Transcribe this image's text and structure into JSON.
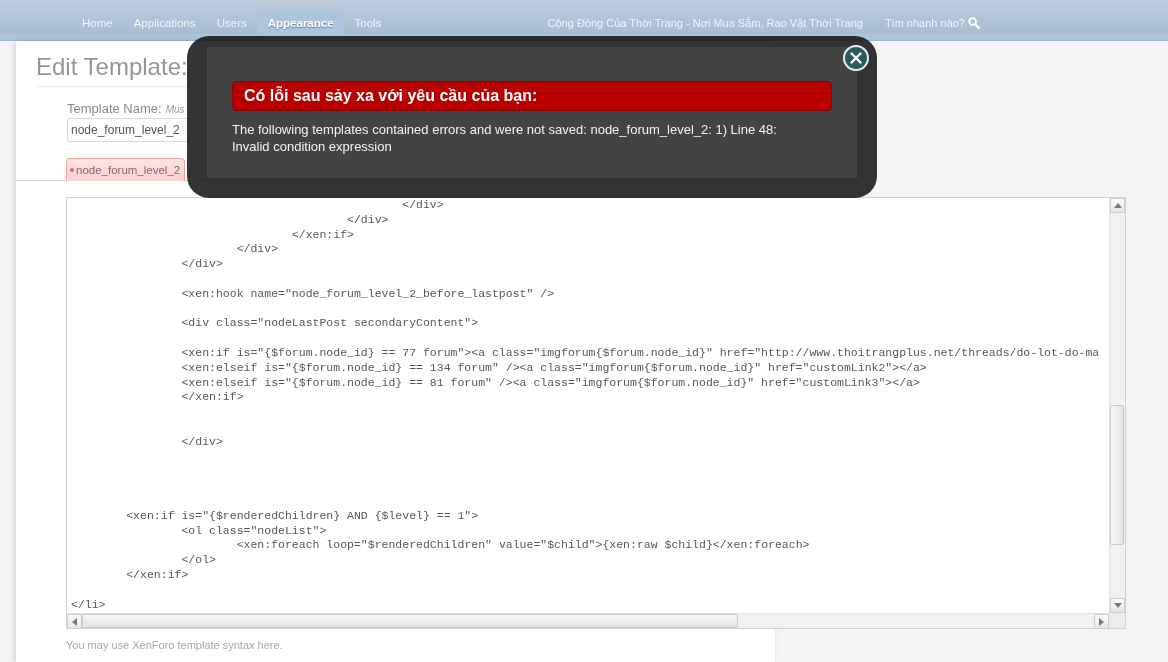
{
  "nav": {
    "tabs": [
      {
        "label": "Home",
        "selected": false
      },
      {
        "label": "Applications",
        "selected": false
      },
      {
        "label": "Users",
        "selected": false
      },
      {
        "label": "Appearance",
        "selected": true
      },
      {
        "label": "Tools",
        "selected": false
      }
    ],
    "site_title": "Cộng Đồng Của Thời Trang - Nơi Mua Sắm, Rao Vặt Thời Trang",
    "search_label": "Tìm nhanh nào?"
  },
  "page": {
    "title": "Edit Template:",
    "template_name": {
      "label": "Template Name:",
      "hint": "Mus",
      "value": "node_forum_level_2"
    },
    "file_tabs": [
      {
        "label": "node_forum_level_2",
        "selected": true,
        "modified": true
      }
    ],
    "editor": {
      "code": "\t\t\t\t\t\t</div>\n\t\t\t\t\t</div>\n\t\t\t\t</xen:if>\n\t\t\t</div>\n\t\t</div>\n\n\t\t<xen:hook name=\"node_forum_level_2_before_lastpost\" />\n\n\t\t<div class=\"nodeLastPost secondaryContent\">\n\n\t\t<xen:if is=\"{$forum.node_id} == 77 forum\"><a class=\"imgforum{$forum.node_id}\" href=\"http://www.thoitrangplus.net/threads/do-lot-do-ma\n\t\t<xen:elseif is=\"{$forum.node_id} == 134 forum\" /><a class=\"imgforum{$forum.node_id}\" href=\"customLink2\"></a>\n\t\t<xen:elseif is=\"{$forum.node_id} == 81 forum\" /><a class=\"imgforum{$forum.node_id}\" href=\"customLink3\"></a>\n\t\t</xen:if>\n\n\n\t\t</div>\n\n\n\n\n\t<xen:if is=\"{$renderedChildren} AND {$level} == 1\">\n\t\t<ol class=\"nodeList\">\n\t\t\t<xen:foreach loop=\"$renderedChildren\" value=\"$child\">{xen:raw $child}</xen:foreach>\n\t\t</ol>\n\t</xen:if>\n\n</li>"
    },
    "help_text": "You may use XenForo template syntax here."
  },
  "error_dialog": {
    "heading": "Có lỗi sau sảy xa với yêu cầu của bạn:",
    "message": "The following templates contained errors and were not saved: node_forum_level_2: 1) Line 48: Invalid condition expression"
  }
}
